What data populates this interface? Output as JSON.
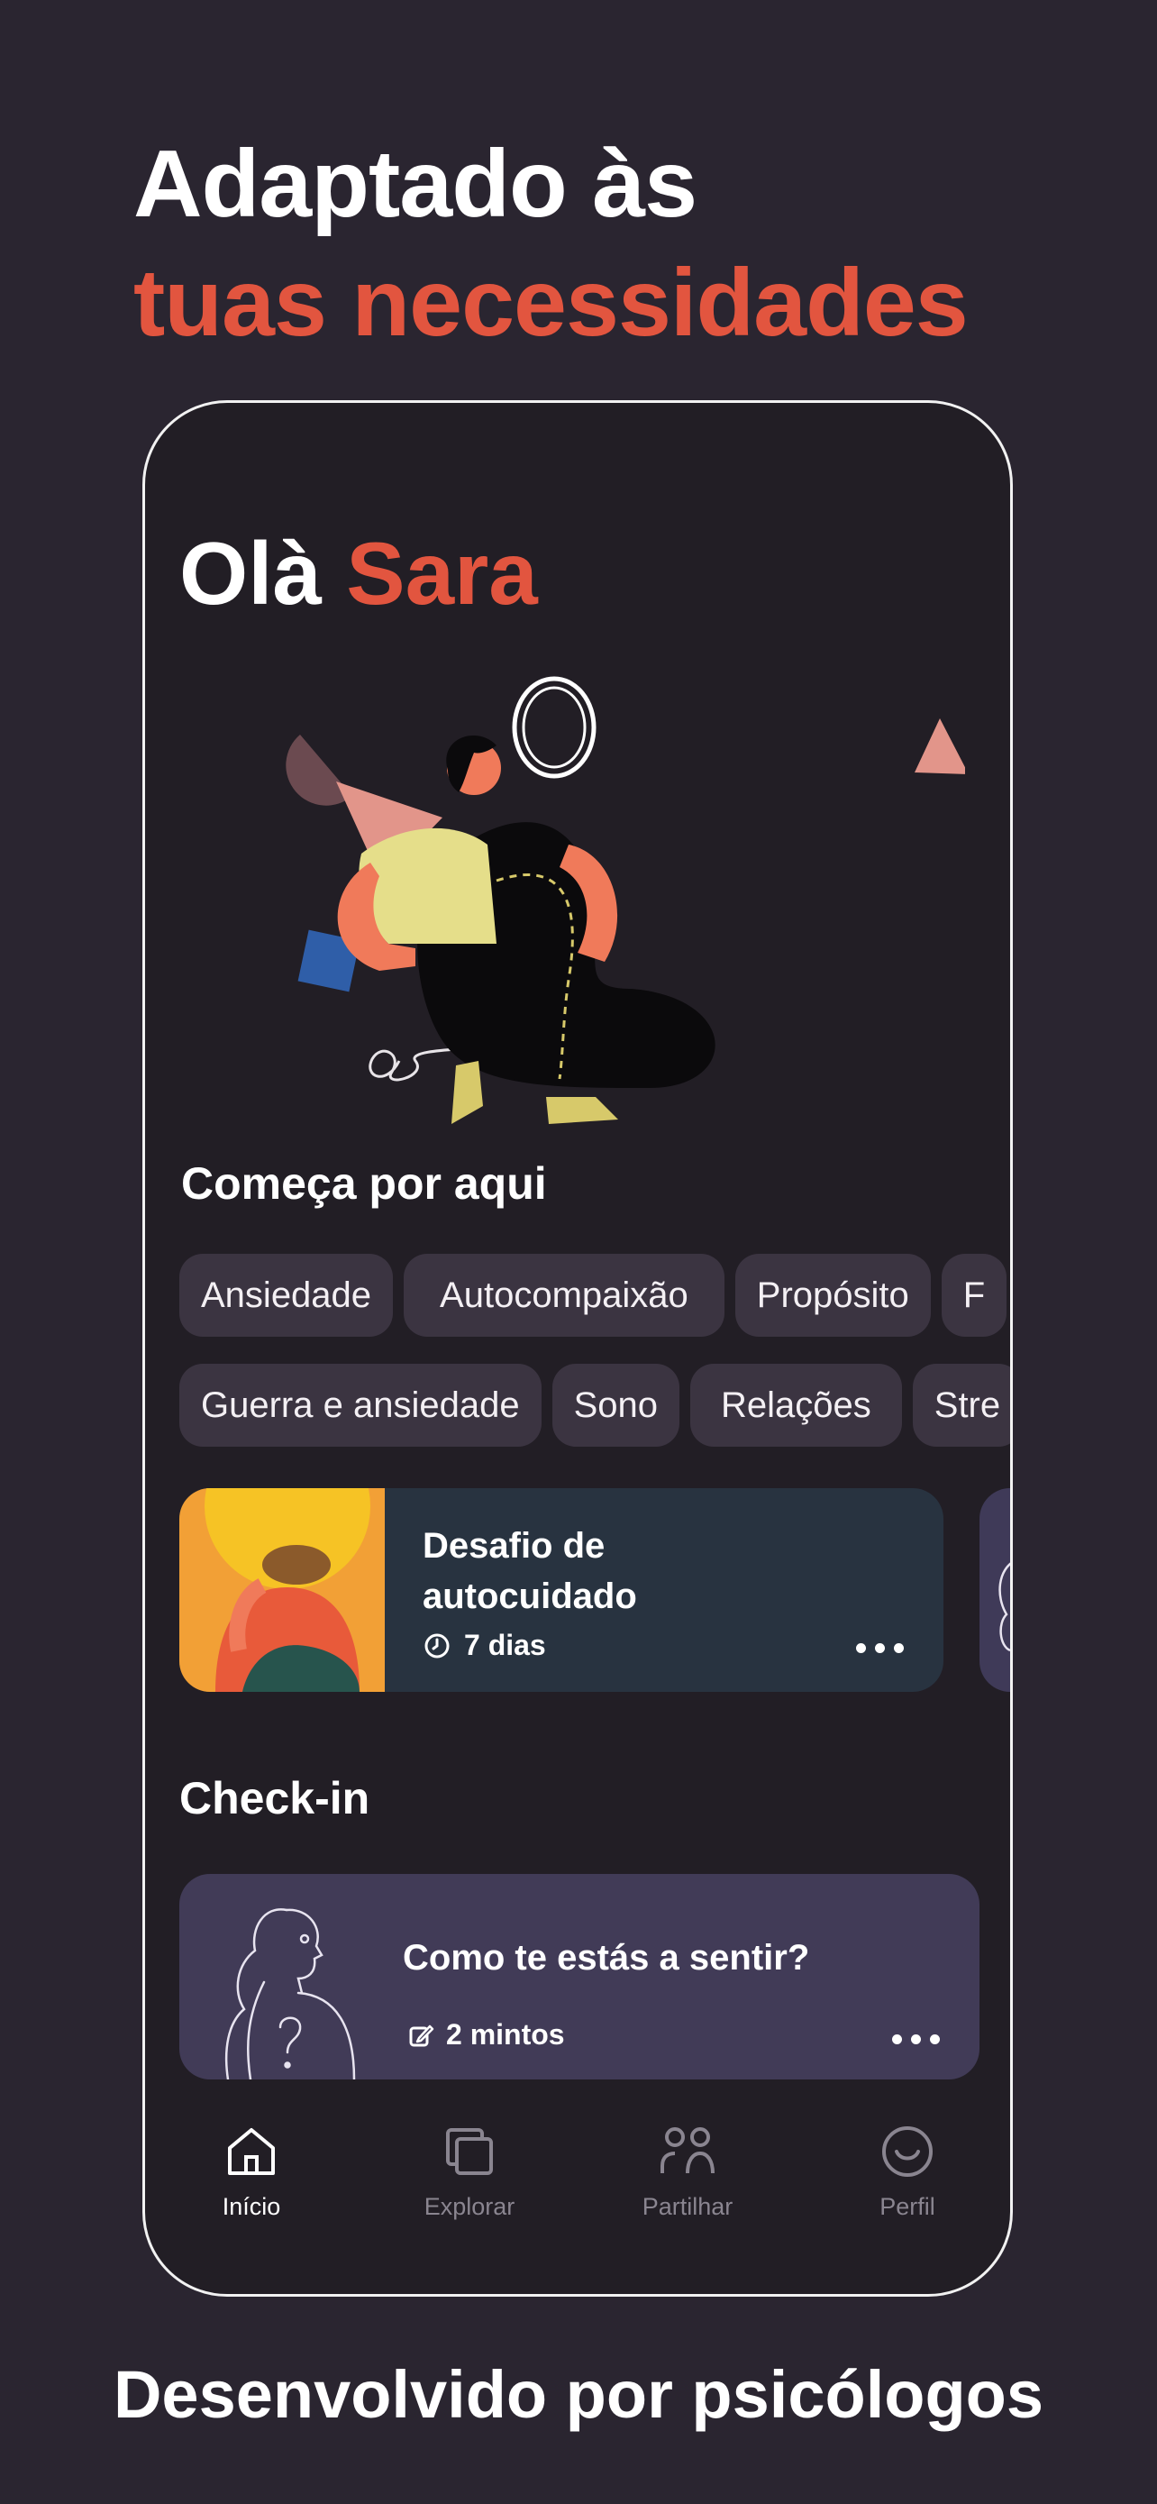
{
  "headline": {
    "line1": "Adaptado às",
    "line2": "tuas necessidades"
  },
  "app": {
    "greeting": {
      "prefix": "Olà",
      "name": "Sara"
    },
    "start_section": {
      "title": "Começa por aqui",
      "chips_row1": [
        "Ansiedade",
        "Autocompaixão",
        "Propósito",
        "F"
      ],
      "chips_row2": [
        "Guerra e ansiedade",
        "Sono",
        "Relações",
        "Stre"
      ]
    },
    "challenge_card": {
      "title_line1": "Desafio de",
      "title_line2": "autocuidado",
      "duration": "7 dias"
    },
    "checkin": {
      "section_title": "Check-in",
      "card_title": "Como te estás a sentir?",
      "duration": "2 mintos"
    },
    "tabs": [
      {
        "label": "Início",
        "icon": "home-icon",
        "active": true
      },
      {
        "label": "Explorar",
        "icon": "explore-icon",
        "active": false
      },
      {
        "label": "Partilhar",
        "icon": "share-people-icon",
        "active": false
      },
      {
        "label": "Perfil",
        "icon": "profile-smile-icon",
        "active": false
      }
    ]
  },
  "footer": "Desenvolvido por psicólogos",
  "colors": {
    "background": "#2a2530",
    "accent": "#e2553f",
    "phone_background": "#221e25",
    "chip_background": "#3b3441",
    "challenge_card": "#283340",
    "checkin_card": "#413b57",
    "tab_inactive": "#8a8590"
  }
}
